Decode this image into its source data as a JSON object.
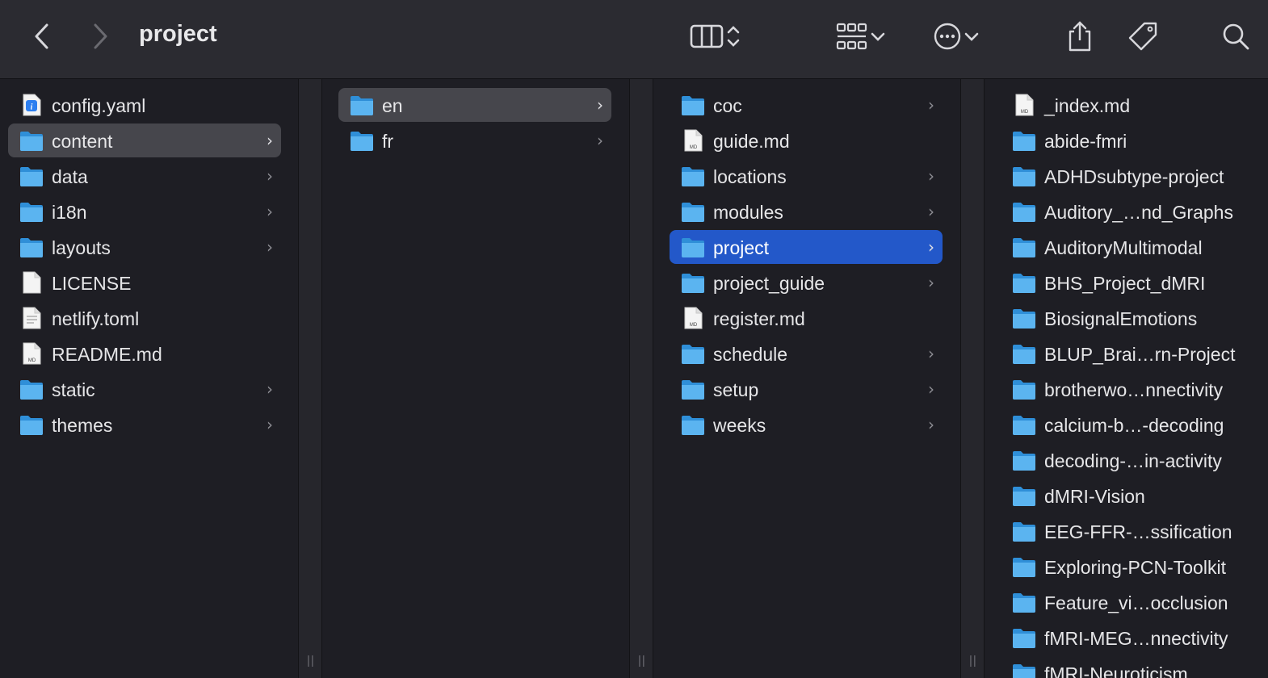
{
  "window": {
    "title": "project"
  },
  "toolbar": {
    "back_icon": "chevron-left-icon",
    "forward_icon": "chevron-right-icon",
    "view_icon": "column-view-icon",
    "group_icon": "group-grid-icon",
    "action_icon": "more-actions-icon",
    "share_icon": "share-icon",
    "tag_icon": "tag-icon",
    "search_icon": "search-icon"
  },
  "colors": {
    "selection_active": "#2358c9",
    "selection_inactive": "#46464c",
    "folder": "#5bb4f0"
  },
  "columns": [
    {
      "items": [
        {
          "label": "config.yaml",
          "kind": "yaml",
          "chevron": false,
          "selected": ""
        },
        {
          "label": "content",
          "kind": "folder",
          "chevron": true,
          "selected": "gray"
        },
        {
          "label": "data",
          "kind": "folder",
          "chevron": true,
          "selected": ""
        },
        {
          "label": "i18n",
          "kind": "folder",
          "chevron": true,
          "selected": ""
        },
        {
          "label": "layouts",
          "kind": "folder",
          "chevron": true,
          "selected": ""
        },
        {
          "label": "LICENSE",
          "kind": "blank",
          "chevron": false,
          "selected": ""
        },
        {
          "label": "netlify.toml",
          "kind": "text",
          "chevron": false,
          "selected": ""
        },
        {
          "label": "README.md",
          "kind": "md",
          "chevron": false,
          "selected": ""
        },
        {
          "label": "static",
          "kind": "folder",
          "chevron": true,
          "selected": ""
        },
        {
          "label": "themes",
          "kind": "folder",
          "chevron": true,
          "selected": ""
        }
      ]
    },
    {
      "items": [
        {
          "label": "en",
          "kind": "folder",
          "chevron": true,
          "selected": "gray"
        },
        {
          "label": "fr",
          "kind": "folder",
          "chevron": true,
          "selected": ""
        }
      ]
    },
    {
      "items": [
        {
          "label": "coc",
          "kind": "folder",
          "chevron": true,
          "selected": ""
        },
        {
          "label": "guide.md",
          "kind": "md",
          "chevron": false,
          "selected": ""
        },
        {
          "label": "locations",
          "kind": "folder",
          "chevron": true,
          "selected": ""
        },
        {
          "label": "modules",
          "kind": "folder",
          "chevron": true,
          "selected": ""
        },
        {
          "label": "project",
          "kind": "folder",
          "chevron": true,
          "selected": "blue"
        },
        {
          "label": "project_guide",
          "kind": "folder",
          "chevron": true,
          "selected": ""
        },
        {
          "label": "register.md",
          "kind": "md",
          "chevron": false,
          "selected": ""
        },
        {
          "label": "schedule",
          "kind": "folder",
          "chevron": true,
          "selected": ""
        },
        {
          "label": "setup",
          "kind": "folder",
          "chevron": true,
          "selected": ""
        },
        {
          "label": "weeks",
          "kind": "folder",
          "chevron": true,
          "selected": ""
        }
      ]
    },
    {
      "items": [
        {
          "label": "_index.md",
          "kind": "md",
          "chevron": false,
          "selected": ""
        },
        {
          "label": "abide-fmri",
          "kind": "folder",
          "chevron": true,
          "selected": ""
        },
        {
          "label": "ADHDsubtype-project",
          "kind": "folder",
          "chevron": true,
          "selected": ""
        },
        {
          "label": "Auditory_…nd_Graphs",
          "kind": "folder",
          "chevron": true,
          "selected": ""
        },
        {
          "label": "AuditoryMultimodal",
          "kind": "folder",
          "chevron": true,
          "selected": ""
        },
        {
          "label": "BHS_Project_dMRI",
          "kind": "folder",
          "chevron": true,
          "selected": ""
        },
        {
          "label": "BiosignalEmotions",
          "kind": "folder",
          "chevron": true,
          "selected": ""
        },
        {
          "label": "BLUP_Brai…rn-Project",
          "kind": "folder",
          "chevron": true,
          "selected": ""
        },
        {
          "label": "brotherwo…nnectivity",
          "kind": "folder",
          "chevron": true,
          "selected": ""
        },
        {
          "label": "calcium-b…-decoding",
          "kind": "folder",
          "chevron": true,
          "selected": ""
        },
        {
          "label": "decoding-…in-activity",
          "kind": "folder",
          "chevron": true,
          "selected": ""
        },
        {
          "label": "dMRI-Vision",
          "kind": "folder",
          "chevron": true,
          "selected": ""
        },
        {
          "label": "EEG-FFR-…ssification",
          "kind": "folder",
          "chevron": true,
          "selected": ""
        },
        {
          "label": "Exploring-PCN-Toolkit",
          "kind": "folder",
          "chevron": true,
          "selected": ""
        },
        {
          "label": "Feature_vi…occlusion",
          "kind": "folder",
          "chevron": true,
          "selected": ""
        },
        {
          "label": "fMRI-MEG…nnectivity",
          "kind": "folder",
          "chevron": true,
          "selected": ""
        },
        {
          "label": "fMRI-Neuroticism",
          "kind": "folder",
          "chevron": true,
          "selected": ""
        }
      ]
    }
  ]
}
